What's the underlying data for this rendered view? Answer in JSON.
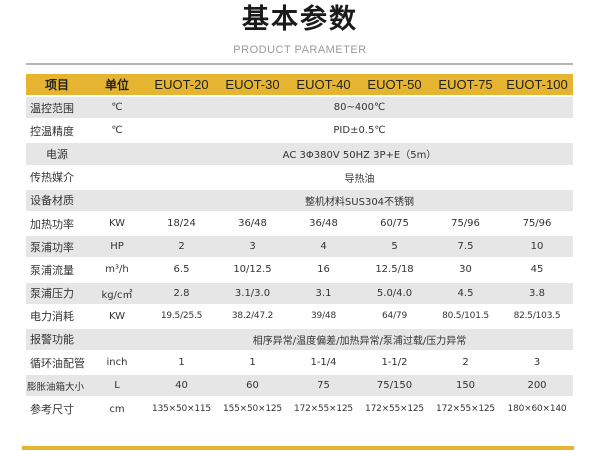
{
  "header": {
    "title": "基本参数",
    "subtitle": "PRODUCT PARAMETER"
  },
  "table": {
    "columns": [
      "项目",
      "单位",
      "EUOT-20",
      "EUOT-30",
      "EUOT-40",
      "EUOT-50",
      "EUOT-75",
      "EUOT-100"
    ],
    "rows": [
      {
        "label": "温控范围",
        "unit": "℃",
        "span": "80~400℃"
      },
      {
        "label": "控温精度",
        "unit": "℃",
        "span": "PID±0.5℃"
      },
      {
        "label": "电源",
        "unit": "",
        "span": "AC 3Φ380V 50HZ 3P+E（5m）"
      },
      {
        "label": "传热媒介",
        "unit": "",
        "span": "导热油"
      },
      {
        "label": "设备材质",
        "unit": "",
        "span": "整机材料SUS304不锈钢"
      },
      {
        "label": "加热功率",
        "unit": "KW",
        "values": [
          "18/24",
          "36/48",
          "36/48",
          "60/75",
          "75/96",
          "75/96"
        ]
      },
      {
        "label": "泵浦功率",
        "unit": "HP",
        "values": [
          "2",
          "3",
          "4",
          "5",
          "7.5",
          "10"
        ]
      },
      {
        "label": "泵浦流量",
        "unit": "m³/h",
        "values": [
          "6.5",
          "10/12.5",
          "16",
          "12.5/18",
          "30",
          "45"
        ]
      },
      {
        "label": "泵浦压力",
        "unit": "kg/c㎡",
        "values": [
          "2.8",
          "3.1/3.0",
          "3.1",
          "5.0/4.0",
          "4.5",
          "3.8"
        ]
      },
      {
        "label": "电力消耗",
        "unit": "KW",
        "values": [
          "19.5/25.5",
          "38.2/47.2",
          "39/48",
          "64/79",
          "80.5/101.5",
          "82.5/103.5"
        ]
      },
      {
        "label": "报警功能",
        "unit": "",
        "span": "相序异常/温度偏差/加热异常/泵浦过载/压力异常"
      },
      {
        "label": "循环油配管",
        "unit": "inch",
        "values": [
          "1",
          "1",
          "1-1/4",
          "1-1/2",
          "2",
          "3"
        ]
      },
      {
        "label": "膨胀油箱大小",
        "unit": "L",
        "values": [
          "40",
          "60",
          "75",
          "75/150",
          "150",
          "200"
        ]
      },
      {
        "label": "参考尺寸",
        "unit": "cm",
        "values": [
          "135×50×115",
          "155×50×125",
          "172×55×125",
          "172×55×125",
          "172×55×125",
          "180×60×140"
        ]
      }
    ]
  }
}
